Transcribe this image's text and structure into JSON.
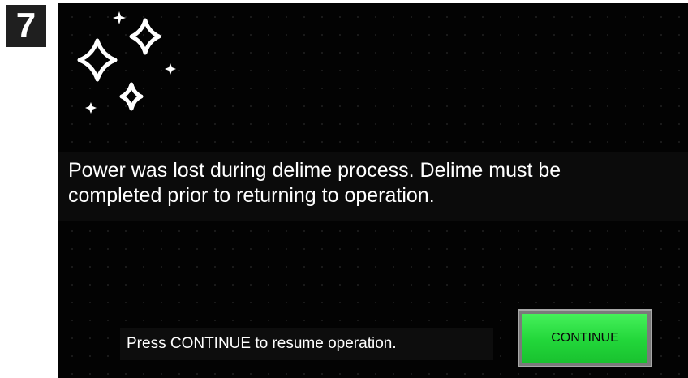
{
  "step": {
    "number": "7"
  },
  "screen": {
    "icon": "sparkles-icon",
    "message": "Power was lost during delime process.  Delime must be\ncompleted prior to returning to operation.",
    "prompt": "Press CONTINUE to resume operation.",
    "continue_label": "CONTINUE"
  },
  "colors": {
    "screen_background": "#030303",
    "text": "#ffffff",
    "button_green": "#22d63a",
    "step_badge": "#1f1f1f"
  }
}
